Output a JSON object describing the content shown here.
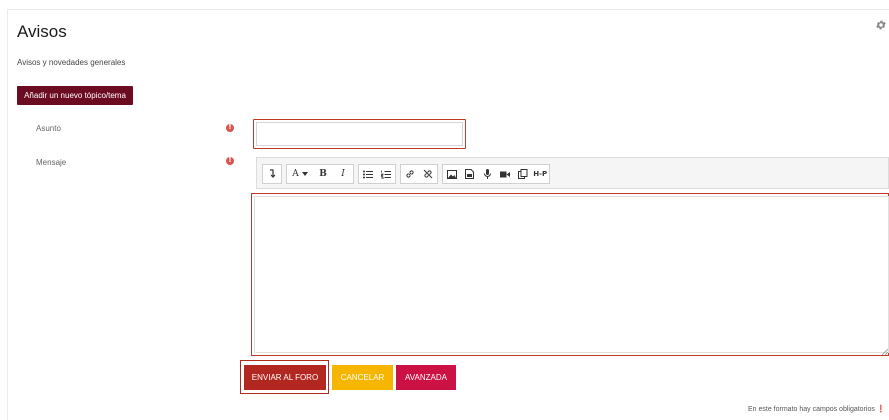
{
  "page": {
    "title": "Avisos",
    "subtitle": "Avisos y novedades generales"
  },
  "actions": {
    "new_topic_label": "Añadir un nuevo tópico/tema"
  },
  "form": {
    "subject_label": "Asunto",
    "subject_value": "",
    "message_label": "Mensaje",
    "message_value": "",
    "required_marker": "!"
  },
  "toolbar": {
    "items": [
      "collapse-icon",
      "font-size-icon",
      "bold-icon",
      "italic-icon",
      "unordered-list-icon",
      "ordered-list-icon",
      "link-icon",
      "unlink-icon",
      "image-icon",
      "media-icon",
      "record-audio-icon",
      "record-video-icon",
      "manage-files-icon",
      "h5p-icon"
    ],
    "font_size_label": "A",
    "bold_label": "B",
    "italic_label": "I",
    "h5p_label": "H-P"
  },
  "buttons": {
    "submit_label": "ENVIAR AL FORO",
    "cancel_label": "CANCELAR",
    "advanced_label": "AVANZADA"
  },
  "footer": {
    "required_note": "En este formato hay campos obligatorios"
  },
  "colors": {
    "primary": "#6c0c23",
    "submit": "#b32721",
    "cancel": "#f6b600",
    "advanced": "#cc1144",
    "required": "#d9534f"
  }
}
